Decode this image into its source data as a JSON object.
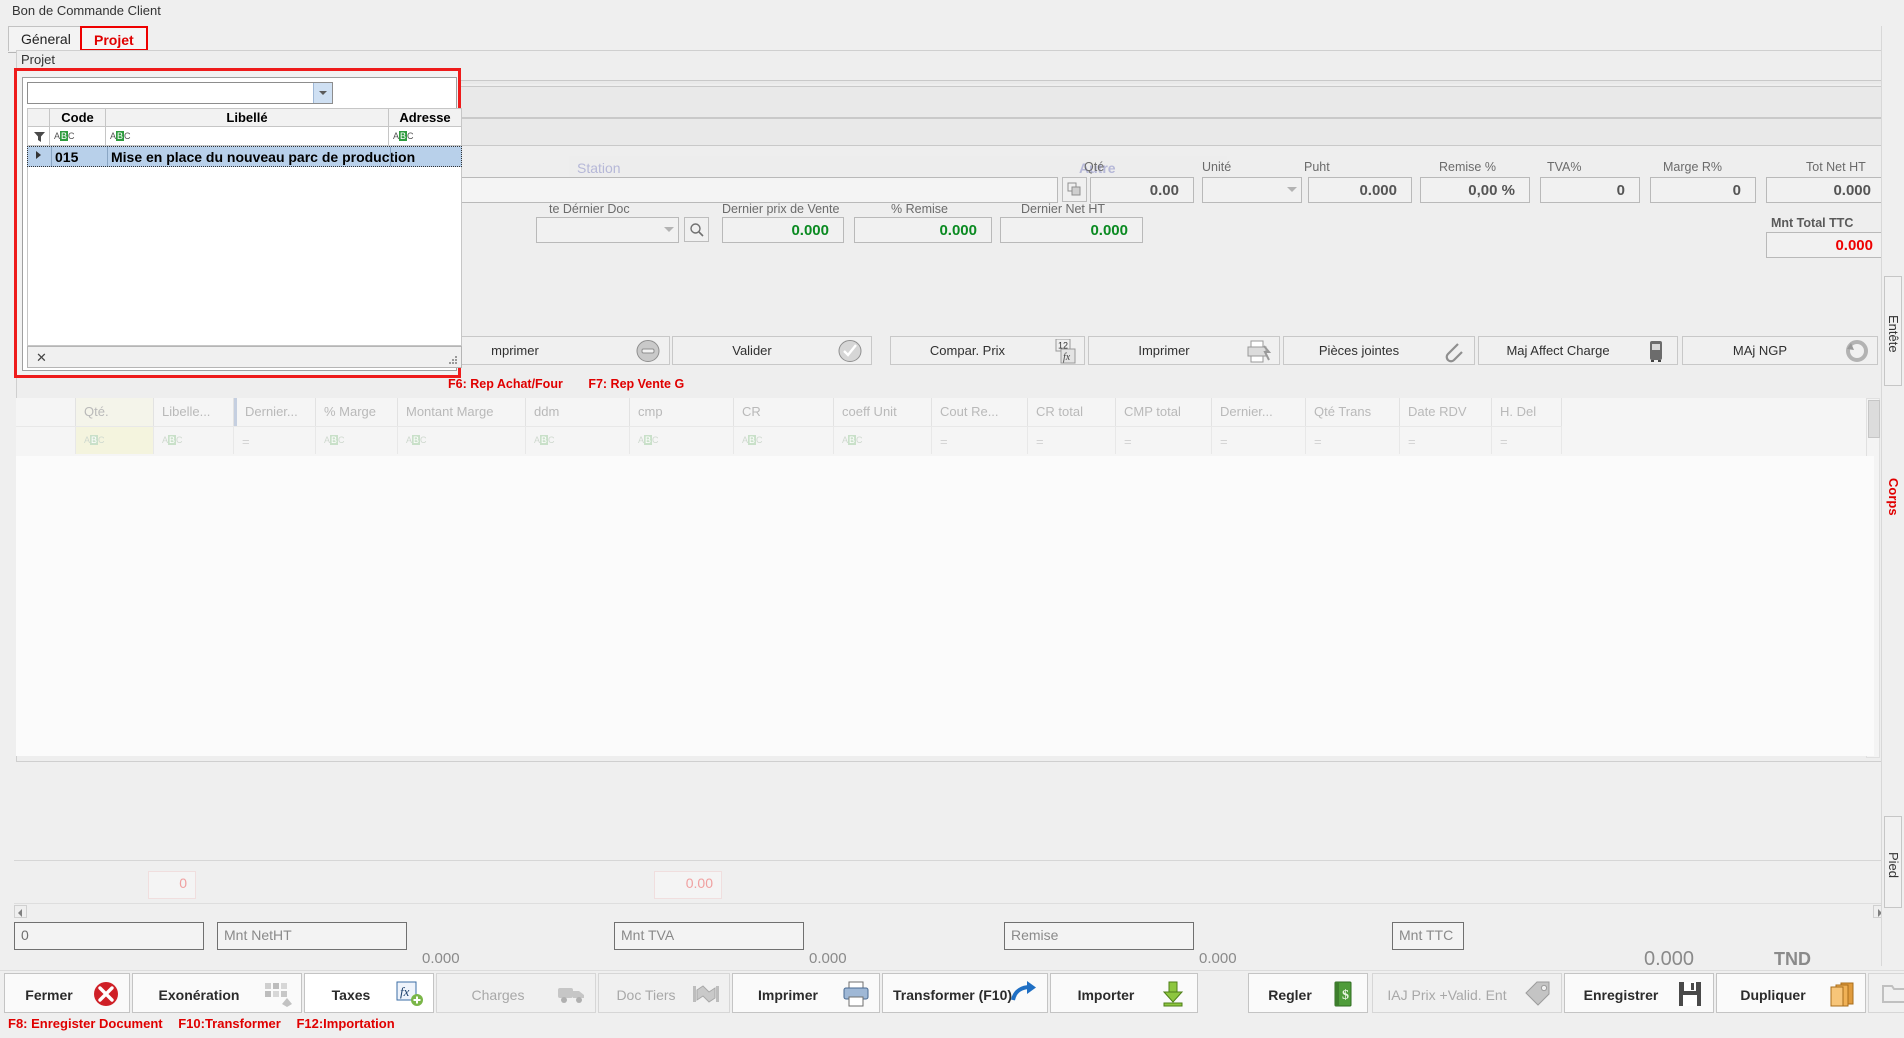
{
  "window": {
    "title": "Bon de Commande Client"
  },
  "tabs": [
    {
      "id": "general",
      "label": "Géneral",
      "active": false
    },
    {
      "id": "projet",
      "label": "Projet",
      "active": true
    }
  ],
  "group": {
    "title": "Projet"
  },
  "popup": {
    "search_value": "",
    "columns": [
      "Code",
      "Libellé",
      "Adresse"
    ],
    "filter_icon": "filter-icon",
    "filter_cells": [
      "abc-filter-icon",
      "abc-filter-icon",
      "abc-filter-icon"
    ],
    "rows": [
      {
        "code": "015",
        "libelle": "Mise en place du nouveau parc de production",
        "adresse": ""
      }
    ],
    "close_label": "✕"
  },
  "entete": {
    "station_placeholder": "Station",
    "autre_label": "Autre",
    "fields": [
      {
        "label": "Qté",
        "value": "0.00"
      },
      {
        "label": "Unité",
        "value": ""
      },
      {
        "label": "Puht",
        "value": "0.000"
      },
      {
        "label": "Remise %",
        "value": "0,00 %"
      },
      {
        "label": "TVA%",
        "value": "0"
      },
      {
        "label": "Marge R%",
        "value": "0"
      },
      {
        "label": "Tot Net HT",
        "value": "0.000"
      }
    ],
    "row2": [
      {
        "label": "te Dérnier Doc",
        "value": ""
      },
      {
        "label": "Dernier prix de Vente",
        "value": "0.000"
      },
      {
        "label": "% Remise",
        "value": "0.000"
      },
      {
        "label": "Dernier Net HT",
        "value": "0.000"
      }
    ],
    "total": {
      "label": "Mnt Total  TTC",
      "value": "0.000"
    }
  },
  "actions": [
    {
      "label": "mprimer",
      "icon": "minus-circle-icon"
    },
    {
      "label": "Valider",
      "icon": "check-circle-icon"
    },
    {
      "label": "Compar. Prix",
      "icon": "fx12-icon"
    },
    {
      "label": "Imprimer",
      "icon": "printer-bolt-icon"
    },
    {
      "label": "Pièces jointes",
      "icon": "paperclip-icon"
    },
    {
      "label": "Maj Affect Charge",
      "icon": "bus-icon"
    },
    {
      "label": "MAj NGP",
      "icon": "undo-circle-icon"
    }
  ],
  "fkeys_top": [
    "F6: Rep Achat/Four",
    "F7: Rep Vente G"
  ],
  "bodygrid": {
    "columns": [
      {
        "label": "",
        "type": "blank"
      },
      {
        "label": "Qté.",
        "type": "abc",
        "highlight": true
      },
      {
        "label": "Libelle...",
        "type": "abc"
      },
      {
        "label": "Dernier...",
        "type": "eq"
      },
      {
        "label": "% Marge",
        "type": "abc"
      },
      {
        "label": "Montant Marge",
        "type": "abc"
      },
      {
        "label": "ddm",
        "type": "abc"
      },
      {
        "label": "cmp",
        "type": "abc"
      },
      {
        "label": "CR",
        "type": "abc"
      },
      {
        "label": "coeff Unit",
        "type": "abc"
      },
      {
        "label": "Cout Re...",
        "type": "eq"
      },
      {
        "label": "CR total",
        "type": "eq"
      },
      {
        "label": "CMP total",
        "type": "eq"
      },
      {
        "label": "Dernier...",
        "type": "eq"
      },
      {
        "label": "Qté Trans",
        "type": "eq"
      },
      {
        "label": "Date RDV",
        "type": "eq"
      },
      {
        "label": "H. Del",
        "type": "eq"
      }
    ]
  },
  "ghost_totals": [
    {
      "value": "0"
    },
    {
      "value": "0.00"
    }
  ],
  "summary": [
    {
      "box": "0",
      "value": ""
    },
    {
      "box": "Mnt NetHT",
      "value": "0.000"
    },
    {
      "box": "Mnt TVA",
      "value": "0.000"
    },
    {
      "box": "Remise",
      "value": "0.000"
    },
    {
      "box": "Mnt TTC",
      "value": "0.000"
    }
  ],
  "currency": "TND",
  "toolbar": [
    {
      "label": "Fermer",
      "icon": "close-circle-icon",
      "disabled": false
    },
    {
      "label": "Exonération",
      "icon": "squares-icon",
      "disabled": false
    },
    {
      "label": "Taxes",
      "icon": "fx-plus-icon",
      "disabled": false
    },
    {
      "label": "Charges",
      "icon": "truck-icon",
      "disabled": true
    },
    {
      "label": "Doc Tiers",
      "icon": "handshake-icon",
      "disabled": true
    },
    {
      "label": "Imprimer",
      "icon": "printer-icon",
      "disabled": false
    },
    {
      "label": "Transformer (F10)",
      "icon": "arrow-right-icon",
      "disabled": false
    },
    {
      "label": "Importer",
      "icon": "download-icon",
      "disabled": false
    },
    {
      "label": "Regler",
      "icon": "money-book-icon",
      "disabled": false
    },
    {
      "label": "IAJ Prix +Valid. Ent",
      "icon": "price-tag-icon",
      "disabled": true
    },
    {
      "label": "Enregistrer",
      "icon": "floppy-icon",
      "disabled": false
    },
    {
      "label": "Dupliquer",
      "icon": "books-icon",
      "disabled": false
    },
    {
      "label": "",
      "icon": "folder-icon",
      "disabled": true
    }
  ],
  "fkeys_bottom": [
    "F8: Enregister Document",
    "F10:Transformer",
    "F12:Importation"
  ],
  "vtabs": [
    {
      "label": "Entête",
      "active": false
    },
    {
      "label": "Corps",
      "active": true
    },
    {
      "label": "Pied",
      "active": false
    }
  ],
  "colors": {
    "accent_red": "#e00000",
    "green_value": "#0a8a21",
    "total_red": "#ee0000",
    "selection": "#b8d0ea"
  }
}
